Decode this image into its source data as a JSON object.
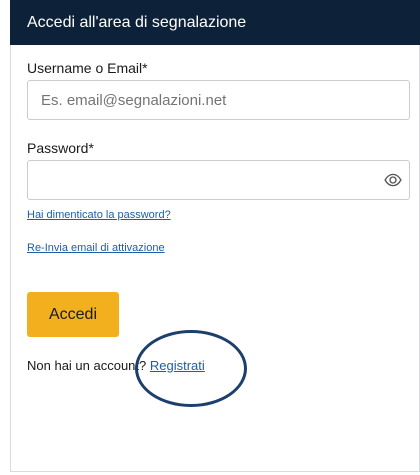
{
  "header": {
    "title": "Accedi all'area di segnalazione"
  },
  "form": {
    "username_label": "Username o Email*",
    "username_placeholder": "Es. email@segnalazioni.net",
    "username_value": "",
    "password_label": "Password*",
    "password_value": "",
    "forgot_link": "Hai dimenticato la password?",
    "resend_link": "Re-Invia email di attivazione",
    "submit_label": "Accedi"
  },
  "signup": {
    "prompt": "Non hai un account? ",
    "link": "Registrati"
  },
  "icons": {
    "password_toggle": "eye-icon"
  },
  "colors": {
    "header_bg": "#0d2238",
    "accent_button": "#f2b01e",
    "link": "#1c5ea8",
    "annotation_circle": "#1c3f6e"
  }
}
